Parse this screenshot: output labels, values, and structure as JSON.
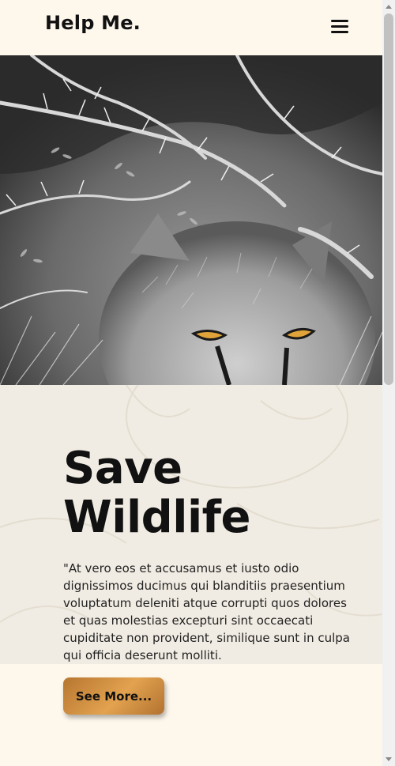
{
  "header": {
    "logo": "Help Me.",
    "menu_icon": "hamburger-menu-icon"
  },
  "hero": {
    "image": "Grayscale photo of a wild cat with orange eyes peering through thorny branches"
  },
  "main": {
    "title_line1": "Save",
    "title_line2": "Wildlife",
    "description": "\"At vero eos et accusamus et iusto odio dignissimos ducimus qui blanditiis praesentium voluptatum deleniti atque corrupti quos dolores et quas molestias excepturi sint occaecati cupiditate non provident, similique sunt in culpa qui officia deserunt molliti.",
    "button_label": "See More..."
  },
  "colors": {
    "page_background": "#fdf7ec",
    "content_background": "#f1ece3",
    "button_accent": "#d1903f",
    "eye_color": "#e0a33a"
  }
}
